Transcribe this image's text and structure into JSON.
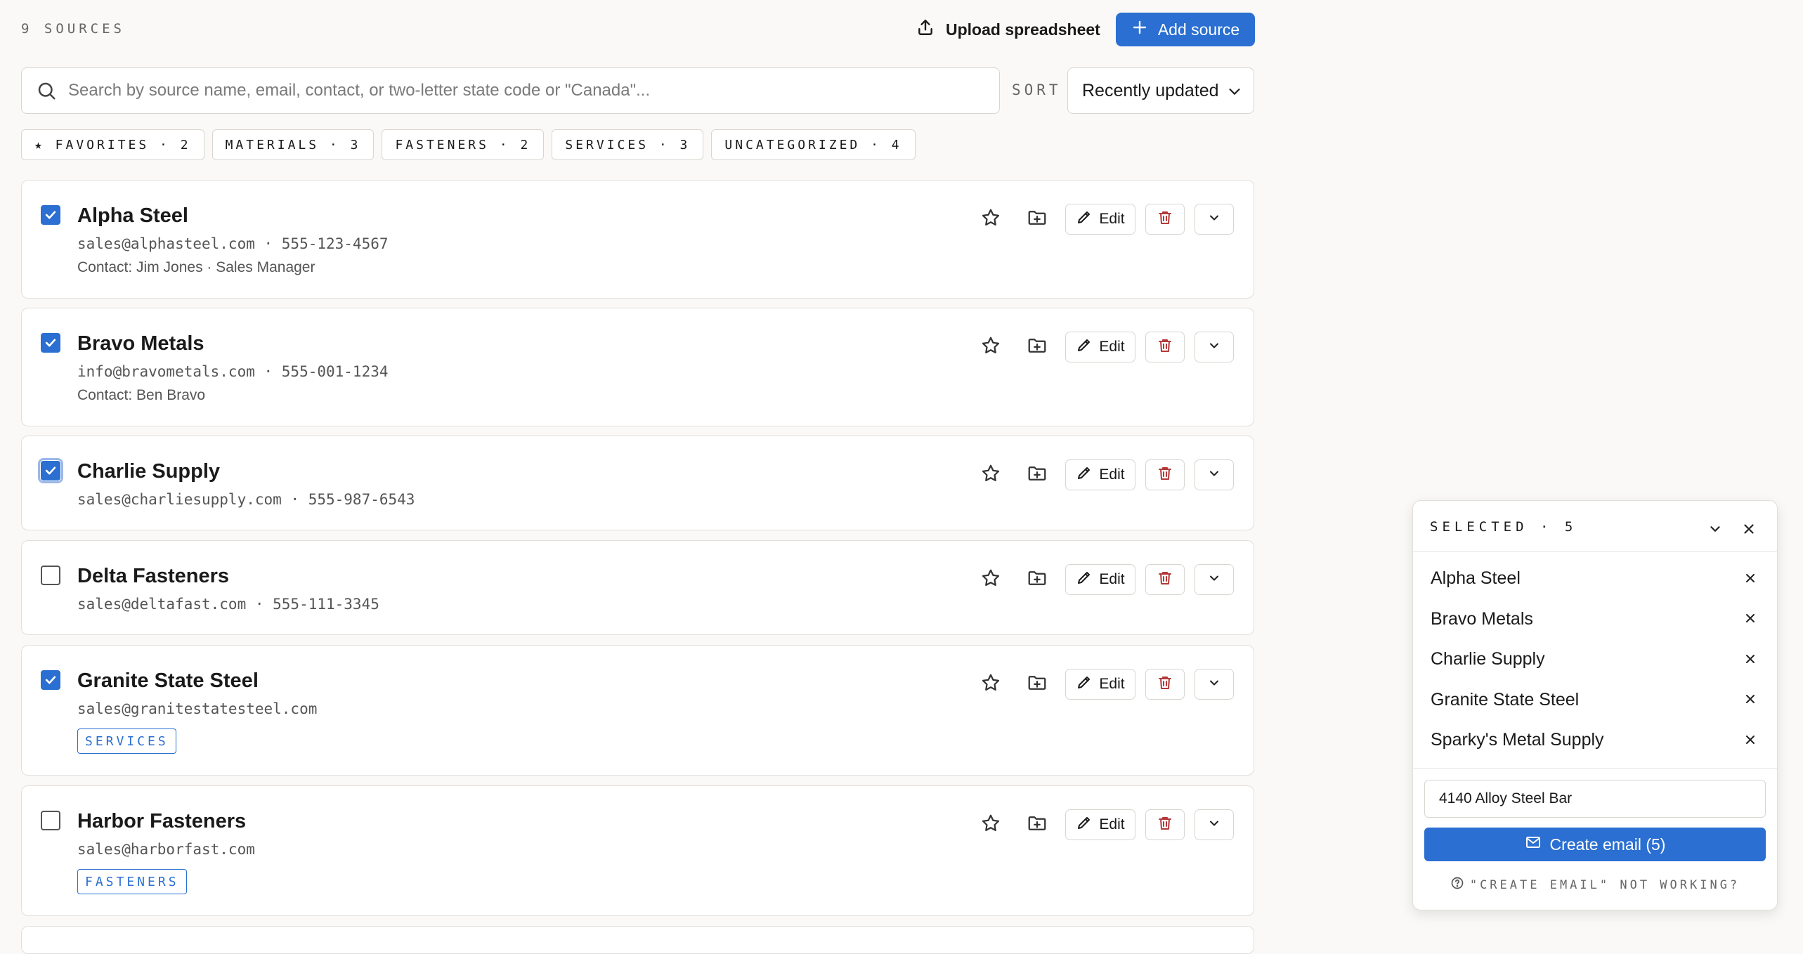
{
  "header": {
    "source_count": "9 SOURCES",
    "upload_label": "Upload spreadsheet",
    "add_label": "Add source"
  },
  "search": {
    "placeholder": "Search by source name, email, contact, or two-letter state code or \"Canada\"...",
    "value": ""
  },
  "sort": {
    "label": "SORT",
    "selected": "Recently updated"
  },
  "chips": [
    {
      "label": "★ FAVORITES · 2"
    },
    {
      "label": "MATERIALS · 3"
    },
    {
      "label": "FASTENERS · 2"
    },
    {
      "label": "SERVICES · 3"
    },
    {
      "label": "UNCATEGORIZED · 4"
    }
  ],
  "sources": [
    {
      "name": "Alpha Steel",
      "meta": "sales@alphasteel.com · 555-123-4567",
      "contact": "Contact: Jim Jones · Sales Manager",
      "tag": "",
      "checked": true,
      "edit": "Edit"
    },
    {
      "name": "Bravo Metals",
      "meta": "info@bravometals.com · 555-001-1234",
      "contact": "Contact: Ben Bravo",
      "tag": "",
      "checked": true,
      "edit": "Edit"
    },
    {
      "name": "Charlie Supply",
      "meta": "sales@charliesupply.com · 555-987-6543",
      "contact": "",
      "tag": "",
      "checked": true,
      "edit": "Edit"
    },
    {
      "name": "Delta Fasteners",
      "meta": "sales@deltafast.com · 555-111-3345",
      "contact": "",
      "tag": "",
      "checked": false,
      "edit": "Edit"
    },
    {
      "name": "Granite State Steel",
      "meta": "sales@granitestatesteel.com",
      "contact": "",
      "tag": "SERVICES",
      "checked": true,
      "edit": "Edit"
    },
    {
      "name": "Harbor Fasteners",
      "meta": "sales@harborfast.com",
      "contact": "",
      "tag": "FASTENERS",
      "checked": false,
      "edit": "Edit"
    }
  ],
  "selected_panel": {
    "title": "SELECTED · 5",
    "items": [
      {
        "name": "Alpha Steel"
      },
      {
        "name": "Bravo Metals"
      },
      {
        "name": "Charlie Supply"
      },
      {
        "name": "Granite State Steel"
      },
      {
        "name": "Sparky's Metal Supply"
      }
    ],
    "subject_value": "4140 Alloy Steel Bar",
    "create_label": "Create email (5)",
    "help_label": "\"CREATE EMAIL\" NOT WORKING?"
  },
  "colors": {
    "accent": "#2a6fd1",
    "danger": "#b23a3a",
    "background": "#faf9f7"
  },
  "icons": {
    "upload": "upload-icon",
    "add": "plus-icon",
    "search": "search-icon",
    "sort": "chevron-down-icon",
    "favorite": "star-icon",
    "move": "folder-plus-icon",
    "edit": "pencil-icon",
    "delete": "trash-icon",
    "more": "chevron-down-icon",
    "remove": "close-icon",
    "mail": "mail-icon",
    "help": "question-circle-icon"
  }
}
